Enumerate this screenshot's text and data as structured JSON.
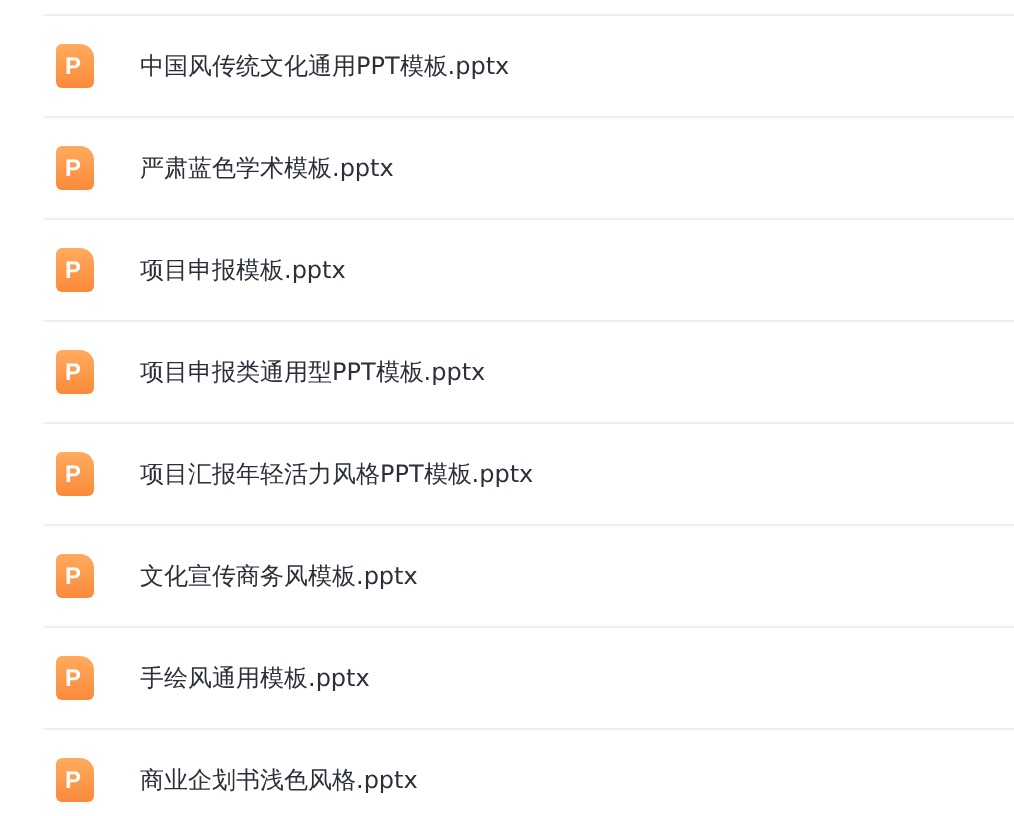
{
  "files": [
    {
      "icon_glyph": "P",
      "name": "中国风传统文化通用PPT模板.pptx"
    },
    {
      "icon_glyph": "P",
      "name": "严肃蓝色学术模板.pptx"
    },
    {
      "icon_glyph": "P",
      "name": "项目申报模板.pptx"
    },
    {
      "icon_glyph": "P",
      "name": "项目申报类通用型PPT模板.pptx"
    },
    {
      "icon_glyph": "P",
      "name": "项目汇报年轻活力风格PPT模板.pptx"
    },
    {
      "icon_glyph": "P",
      "name": "文化宣传商务风模板.pptx"
    },
    {
      "icon_glyph": "P",
      "name": "手绘风通用模板.pptx"
    },
    {
      "icon_glyph": "P",
      "name": "商业企划书浅色风格.pptx"
    }
  ]
}
